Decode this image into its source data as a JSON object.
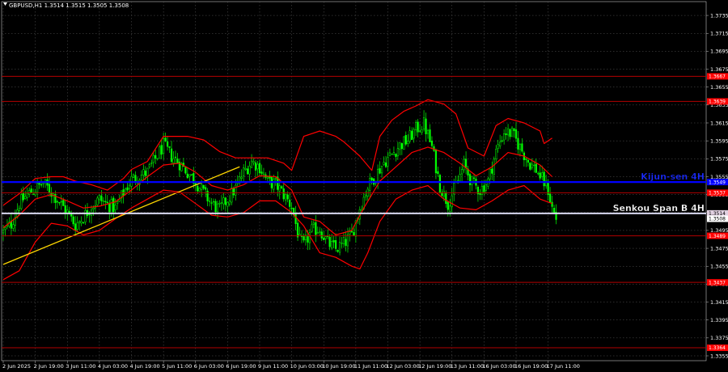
{
  "chart_title": "GBPUSD,H1  1.3514 1.3515 1.3505 1.3508",
  "colors": {
    "background": "#000000",
    "grid": "#5a5a5a",
    "candle_up": "#00ff00",
    "candle_down": "#00ff00",
    "ichimoku": "#ff0000",
    "kijun_4h": "#0000ff",
    "senkou_4h": "#d8d8f0",
    "level": "#b20000",
    "trendline": "#ffd700",
    "axis_text": "#ffffff"
  },
  "chart_data": {
    "type": "candlestick",
    "symbol": "GBPUSD",
    "timeframe": "H1",
    "title": "GBPUSD,H1  1.3514 1.3515 1.3505 1.3508",
    "ylim": [
      1.3355,
      1.3745
    ],
    "y_ticks": [
      "1.3735",
      "1.3715",
      "1.3695",
      "1.3675",
      "1.3655",
      "1.3635",
      "1.3615",
      "1.3595",
      "1.3575",
      "1.3555",
      "1.3535",
      "1.3515",
      "1.3495",
      "1.3475",
      "1.3455",
      "1.3435",
      "1.3415",
      "1.3395",
      "1.3375",
      "1.3355"
    ],
    "x_labels": [
      "2 Jun 2025",
      "2 Jun 19:00",
      "3 Jun 11:00",
      "4 Jun 03:00",
      "4 Jun 19:00",
      "5 Jun 11:00",
      "6 Jun 03:00",
      "6 Jun 19:00",
      "9 Jun 11:00",
      "10 Jun 03:00",
      "10 Jun 19:00",
      "11 Jun 11:00",
      "12 Jun 03:00",
      "12 Jun 19:00",
      "13 Jun 11:00",
      "16 Jun 03:00",
      "16 Jun 19:00",
      "17 Jun 11:00"
    ],
    "horizontal_levels": [
      {
        "price": 1.3667,
        "label": "1.3667",
        "style": "level"
      },
      {
        "price": 1.3639,
        "label": "1.3639",
        "style": "level"
      },
      {
        "price": 1.3549,
        "label": "1.3549",
        "name": "Kijun-sen 4H",
        "style": "kijun"
      },
      {
        "price": 1.3537,
        "label": "1.3537",
        "style": "level"
      },
      {
        "price": 1.3514,
        "label": "1.3514",
        "name": "Senkou Span B 4H",
        "style": "senkou"
      },
      {
        "price": 1.3489,
        "label": "1.3489",
        "style": "level"
      },
      {
        "price": 1.3437,
        "label": "1.3437",
        "style": "level"
      },
      {
        "price": 1.3364,
        "label": "1.3364",
        "style": "level"
      }
    ],
    "current_price": {
      "price": 1.3508,
      "label": "1.3508"
    },
    "close_path": [
      [
        0,
        1.3493
      ],
      [
        4,
        1.3502
      ],
      [
        8,
        1.3525
      ],
      [
        12,
        1.3535
      ],
      [
        16,
        1.3541
      ],
      [
        20,
        1.3548
      ],
      [
        24,
        1.3538
      ],
      [
        28,
        1.3527
      ],
      [
        32,
        1.3515
      ],
      [
        36,
        1.3501
      ],
      [
        40,
        1.351
      ],
      [
        44,
        1.3522
      ],
      [
        48,
        1.353
      ],
      [
        52,
        1.3524
      ],
      [
        56,
        1.352
      ],
      [
        60,
        1.3537
      ],
      [
        64,
        1.3552
      ],
      [
        68,
        1.3556
      ],
      [
        72,
        1.356
      ],
      [
        76,
        1.3575
      ],
      [
        80,
        1.359
      ],
      [
        84,
        1.3578
      ],
      [
        88,
        1.357
      ],
      [
        92,
        1.356
      ],
      [
        96,
        1.355
      ],
      [
        100,
        1.3537
      ],
      [
        104,
        1.3525
      ],
      [
        108,
        1.3518
      ],
      [
        112,
        1.353
      ],
      [
        116,
        1.3542
      ],
      [
        120,
        1.356
      ],
      [
        124,
        1.3572
      ],
      [
        128,
        1.3566
      ],
      [
        132,
        1.3549
      ],
      [
        136,
        1.3547
      ],
      [
        140,
        1.3535
      ],
      [
        144,
        1.3522
      ],
      [
        148,
        1.3483
      ],
      [
        150,
        1.3478
      ],
      [
        154,
        1.3495
      ],
      [
        158,
        1.3497
      ],
      [
        162,
        1.3481
      ],
      [
        166,
        1.3474
      ],
      [
        170,
        1.348
      ],
      [
        174,
        1.349
      ],
      [
        178,
        1.352
      ],
      [
        182,
        1.3544
      ],
      [
        186,
        1.3557
      ],
      [
        190,
        1.3571
      ],
      [
        194,
        1.358
      ],
      [
        198,
        1.359
      ],
      [
        202,
        1.3596
      ],
      [
        206,
        1.3608
      ],
      [
        210,
        1.3614
      ],
      [
        214,
        1.3588
      ],
      [
        218,
        1.3545
      ],
      [
        222,
        1.3525
      ],
      [
        226,
        1.3545
      ],
      [
        230,
        1.3568
      ],
      [
        234,
        1.3548
      ],
      [
        238,
        1.354
      ],
      [
        242,
        1.355
      ],
      [
        246,
        1.3583
      ],
      [
        250,
        1.3605
      ],
      [
        254,
        1.3603
      ],
      [
        258,
        1.3588
      ],
      [
        262,
        1.3572
      ],
      [
        266,
        1.3563
      ],
      [
        270,
        1.3548
      ],
      [
        272,
        1.354
      ],
      [
        274,
        1.352
      ],
      [
        276,
        1.3508
      ]
    ],
    "ichimoku_lines": [
      {
        "role": "upper",
        "points": [
          [
            0,
            1.3523
          ],
          [
            8,
            1.3536
          ],
          [
            16,
            1.3553
          ],
          [
            24,
            1.3555
          ],
          [
            30,
            1.3555
          ],
          [
            36,
            1.355
          ],
          [
            44,
            1.3546
          ],
          [
            52,
            1.354
          ],
          [
            60,
            1.3553
          ],
          [
            64,
            1.3563
          ],
          [
            72,
            1.3572
          ],
          [
            80,
            1.36
          ],
          [
            92,
            1.36
          ],
          [
            100,
            1.3596
          ],
          [
            108,
            1.3583
          ],
          [
            116,
            1.3576
          ],
          [
            124,
            1.3576
          ],
          [
            132,
            1.3576
          ],
          [
            140,
            1.357
          ],
          [
            144,
            1.3562
          ],
          [
            150,
            1.36
          ],
          [
            158,
            1.3606
          ],
          [
            166,
            1.36
          ],
          [
            170,
            1.3594
          ],
          [
            178,
            1.3578
          ],
          [
            184,
            1.3562
          ],
          [
            188,
            1.36
          ],
          [
            194,
            1.3618
          ],
          [
            200,
            1.3628
          ],
          [
            206,
            1.3634
          ],
          [
            212,
            1.3641
          ],
          [
            220,
            1.3636
          ],
          [
            226,
            1.3625
          ],
          [
            232,
            1.3587
          ],
          [
            240,
            1.3578
          ],
          [
            246,
            1.3612
          ],
          [
            252,
            1.362
          ],
          [
            260,
            1.3615
          ],
          [
            268,
            1.3606
          ],
          [
            270,
            1.3592
          ],
          [
            274,
            1.3598
          ]
        ]
      },
      {
        "role": "middle",
        "points": [
          [
            0,
            1.3498
          ],
          [
            8,
            1.3512
          ],
          [
            16,
            1.353
          ],
          [
            24,
            1.3535
          ],
          [
            32,
            1.3528
          ],
          [
            40,
            1.352
          ],
          [
            48,
            1.3522
          ],
          [
            56,
            1.3527
          ],
          [
            64,
            1.354
          ],
          [
            72,
            1.3555
          ],
          [
            80,
            1.3568
          ],
          [
            88,
            1.357
          ],
          [
            96,
            1.356
          ],
          [
            104,
            1.3545
          ],
          [
            112,
            1.354
          ],
          [
            120,
            1.3546
          ],
          [
            128,
            1.3556
          ],
          [
            136,
            1.3555
          ],
          [
            144,
            1.354
          ],
          [
            150,
            1.351
          ],
          [
            158,
            1.3505
          ],
          [
            166,
            1.349
          ],
          [
            174,
            1.3495
          ],
          [
            180,
            1.352
          ],
          [
            188,
            1.355
          ],
          [
            196,
            1.3566
          ],
          [
            204,
            1.3582
          ],
          [
            212,
            1.3588
          ],
          [
            220,
            1.3582
          ],
          [
            228,
            1.357
          ],
          [
            236,
            1.3556
          ],
          [
            244,
            1.3566
          ],
          [
            252,
            1.3582
          ],
          [
            260,
            1.3578
          ],
          [
            268,
            1.3568
          ],
          [
            274,
            1.3555
          ]
        ]
      },
      {
        "role": "lower",
        "points": [
          [
            0,
            1.344
          ],
          [
            8,
            1.345
          ],
          [
            16,
            1.3482
          ],
          [
            24,
            1.3503
          ],
          [
            32,
            1.35
          ],
          [
            40,
            1.349
          ],
          [
            48,
            1.3495
          ],
          [
            56,
            1.3508
          ],
          [
            64,
            1.352
          ],
          [
            72,
            1.353
          ],
          [
            80,
            1.354
          ],
          [
            88,
            1.3538
          ],
          [
            96,
            1.3525
          ],
          [
            104,
            1.3512
          ],
          [
            112,
            1.351
          ],
          [
            120,
            1.3515
          ],
          [
            128,
            1.3528
          ],
          [
            136,
            1.3528
          ],
          [
            144,
            1.3515
          ],
          [
            150,
            1.35
          ],
          [
            158,
            1.347
          ],
          [
            166,
            1.3465
          ],
          [
            174,
            1.3455
          ],
          [
            178,
            1.3452
          ],
          [
            182,
            1.347
          ],
          [
            188,
            1.3505
          ],
          [
            196,
            1.353
          ],
          [
            204,
            1.354
          ],
          [
            212,
            1.3545
          ],
          [
            220,
            1.353
          ],
          [
            228,
            1.352
          ],
          [
            236,
            1.3518
          ],
          [
            244,
            1.3528
          ],
          [
            252,
            1.354
          ],
          [
            260,
            1.3545
          ],
          [
            268,
            1.353
          ],
          [
            274,
            1.3525
          ]
        ]
      }
    ],
    "trendline": {
      "from": [
        0,
        1.3457
      ],
      "to": [
        118,
        1.3566
      ]
    }
  }
}
